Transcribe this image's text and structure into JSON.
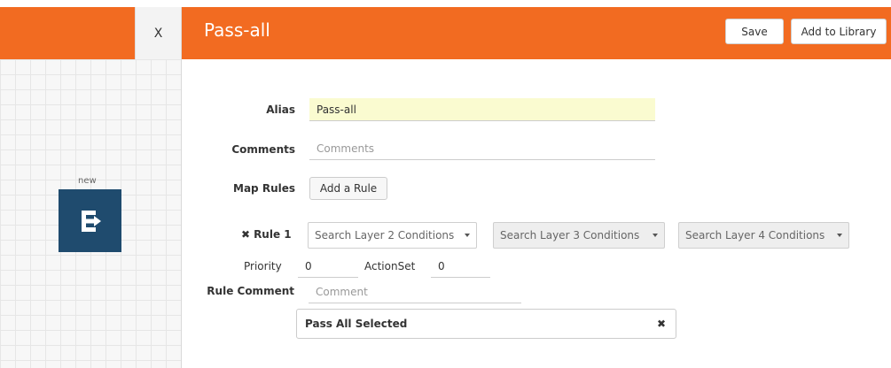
{
  "header": {
    "close_label": "X",
    "title": "Pass-all",
    "save_label": "Save",
    "add_library_label": "Add to Library"
  },
  "canvas": {
    "node_label": "new",
    "node_icon": "E-arrow-icon"
  },
  "form": {
    "alias_label": "Alias",
    "alias_value": "Pass-all",
    "comments_label": "Comments",
    "comments_placeholder": "Comments",
    "map_rules_label": "Map Rules",
    "add_rule_label": "Add a Rule"
  },
  "rule": {
    "remove_glyph": "✖",
    "label": "Rule 1",
    "layer2_placeholder": "Search Layer 2 Conditions",
    "layer3_placeholder": "Search Layer 3 Conditions",
    "layer4_placeholder": "Search Layer 4 Conditions",
    "priority_label": "Priority",
    "priority_value": "0",
    "actionset_label": "ActionSet",
    "actionset_value": "0",
    "rule_comment_label": "Rule Comment",
    "rule_comment_placeholder": "Comment",
    "pass_all_label": "Pass All Selected",
    "pass_all_close_glyph": "✖"
  },
  "colors": {
    "header": "#f26b21",
    "node": "#1f4b6e",
    "alias_highlight": "#fafbd0"
  }
}
